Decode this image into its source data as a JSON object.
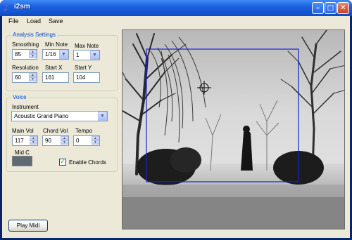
{
  "window": {
    "title": "i2sm",
    "controls": {
      "minimize": "–",
      "maximize": "□",
      "close": "✕"
    }
  },
  "menu": [
    "File",
    "Load",
    "Save"
  ],
  "analysis": {
    "title": "Analysis Settings",
    "smoothing": {
      "label": "Smoothing",
      "value": "85"
    },
    "min_note": {
      "label": "Min Note",
      "value": "1/16"
    },
    "max_note": {
      "label": "Max Note",
      "value": "1"
    },
    "resolution": {
      "label": "Resolution",
      "value": "60"
    },
    "start_x": {
      "label": "Start X",
      "value": "161"
    },
    "start_y": {
      "label": "Start Y",
      "value": "104"
    }
  },
  "voice": {
    "title": "Voice",
    "instrument": {
      "label": "Instrument",
      "value": "Acoustic Grand Piano"
    },
    "main_vol": {
      "label": "Main Vol",
      "value": "117"
    },
    "chord_vol": {
      "label": "Chord Vol",
      "value": "90"
    },
    "tempo": {
      "label": "Tempo",
      "value": "0"
    },
    "mid_c": {
      "label": "Mid C",
      "color": "#5e6b75"
    },
    "enable_chords": {
      "label": "Enable Chords",
      "checked": true
    }
  },
  "play_button": "Play Midi",
  "colors": {
    "title_bar": "#1b5fdc",
    "client_bg": "#ece9d8",
    "group_title": "#0046d5",
    "selection_box": "#1e1ed0"
  },
  "image": {
    "description_icon": "crosshair-icon"
  }
}
